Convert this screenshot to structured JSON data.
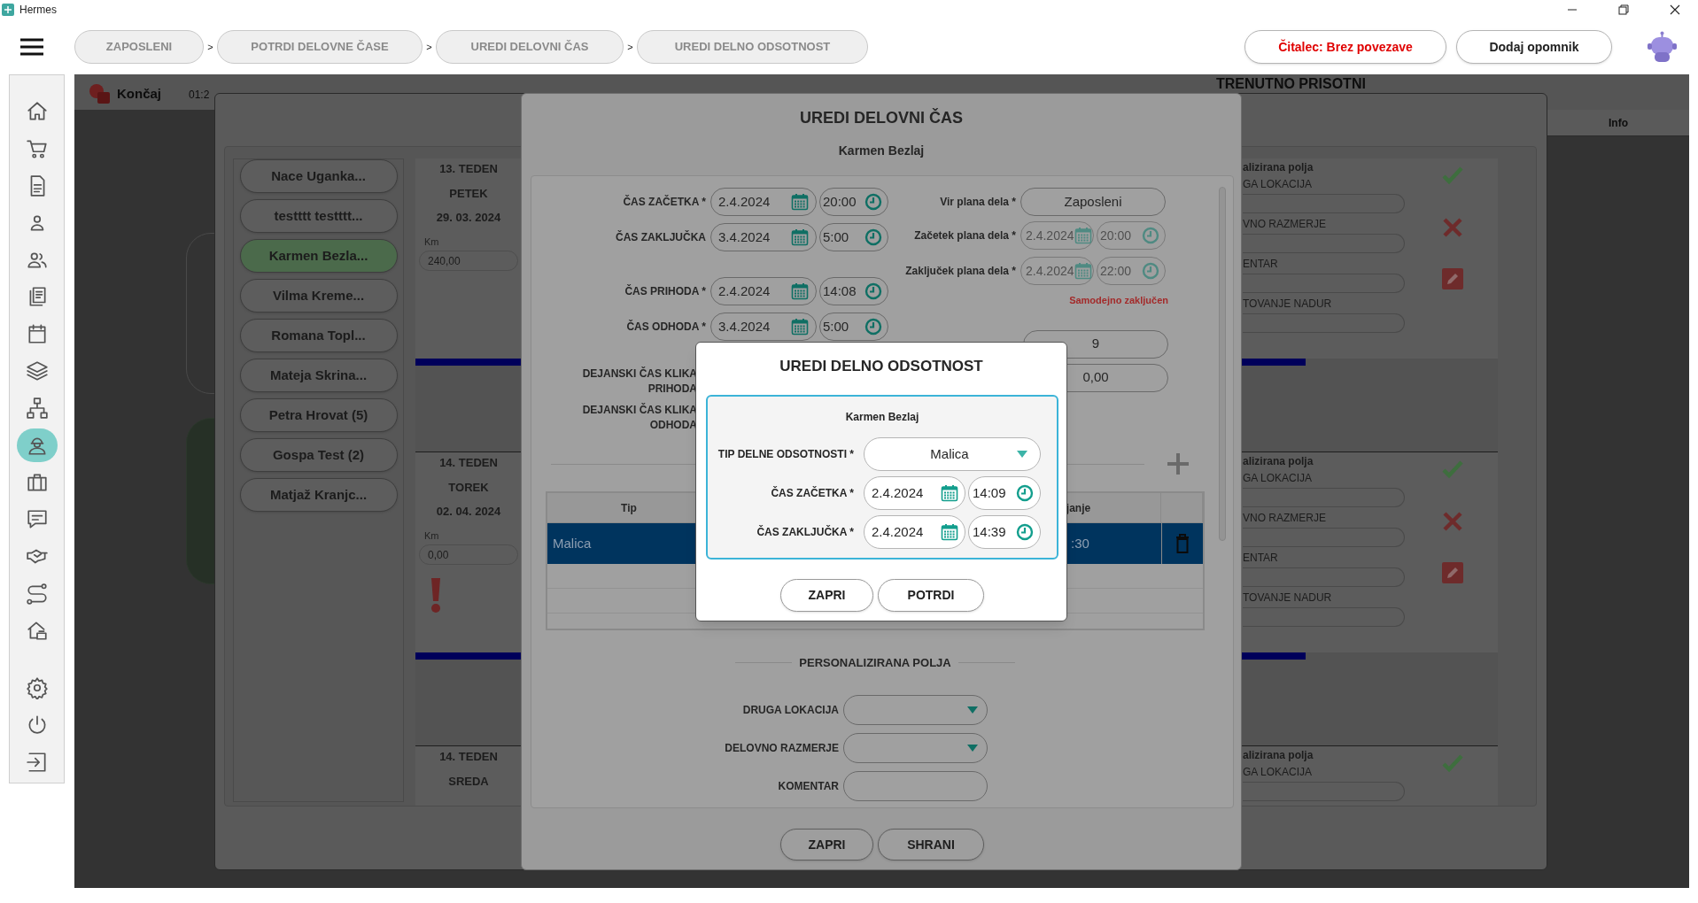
{
  "window": {
    "title": "Hermes"
  },
  "breadcrumbs": [
    {
      "label": "ZAPOSLENI"
    },
    {
      "separator": ">",
      "label": "POTRDI DELOVNE ČASE"
    },
    {
      "separator": ">",
      "label": "UREDI DELOVNI ČAS"
    },
    {
      "separator": ">",
      "label": "UREDI DELNO ODSOTNOST"
    }
  ],
  "header_buttons": [
    {
      "label": "Čitalec: Brez povezave",
      "kind": "alert"
    },
    {
      "label": "Dodaj opomnik",
      "kind": "plain"
    }
  ],
  "sidebar": {
    "items": [
      {
        "kind": "home",
        "selected": false
      },
      {
        "kind": "cart",
        "selected": false
      },
      {
        "kind": "document",
        "selected": false
      },
      {
        "kind": "person",
        "selected": false
      },
      {
        "kind": "people",
        "selected": false
      },
      {
        "kind": "documents",
        "selected": false
      },
      {
        "kind": "calendar",
        "selected": false
      },
      {
        "kind": "layers",
        "selected": false
      },
      {
        "kind": "network",
        "selected": false
      },
      {
        "kind": "worker",
        "selected": true
      },
      {
        "kind": "briefcase",
        "selected": false
      },
      {
        "kind": "chat",
        "selected": false
      },
      {
        "kind": "handshake",
        "selected": false
      },
      {
        "kind": "route",
        "selected": false
      },
      {
        "kind": "house",
        "selected": false
      },
      {
        "kind": "settings",
        "selected": false
      },
      {
        "kind": "power",
        "selected": false
      },
      {
        "kind": "exit",
        "selected": false
      }
    ]
  },
  "background": {
    "end_label": "Končaj",
    "timer": "01:2",
    "present_title": "TRENUTNO PRISOTNI",
    "present_column": "Info"
  },
  "employees": [
    {
      "label": "Nace Uganka...",
      "selected": false
    },
    {
      "label": "testttt testttt...",
      "selected": false
    },
    {
      "label": "Karmen Bezla...",
      "selected": true
    },
    {
      "label": "Vilma Kreme...",
      "selected": false
    },
    {
      "label": "Romana Topl...",
      "selected": false
    },
    {
      "label": "Mateja Skrina...",
      "selected": false
    },
    {
      "label": "Petra Hrovat (5)",
      "selected": false
    },
    {
      "label": "Gospa Test (2)",
      "selected": false
    },
    {
      "label": "Matjaž Kranjc...",
      "selected": false
    }
  ],
  "days": [
    {
      "week": "13. TEDEN",
      "day": "PETEK",
      "date": "29. 03. 2024",
      "km_label": "Km",
      "km": "240,00",
      "warning": false,
      "panel": {
        "heading": "alizirana polja",
        "fields": [
          "GA LOKACIJA",
          "VNO RAZMERJE",
          "ENTAR",
          "TOVANJE NADUR"
        ],
        "actions": [
          {
            "kind": "confirm"
          },
          {
            "kind": "reject"
          },
          {
            "kind": "edit"
          }
        ]
      }
    },
    {
      "week": "14. TEDEN",
      "day": "TOREK",
      "date": "02. 04. 2024",
      "km_label": "Km",
      "km": "0,00",
      "warning": true,
      "panel": {
        "heading": "alizirana polja",
        "fields": [
          "GA LOKACIJA",
          "VNO RAZMERJE",
          "ENTAR",
          "TOVANJE NADUR"
        ],
        "actions": [
          {
            "kind": "confirm"
          },
          {
            "kind": "reject"
          },
          {
            "kind": "edit"
          }
        ]
      }
    },
    {
      "week": "14. TEDEN",
      "day": "SREDA",
      "panel": {
        "heading": "alizirana polja",
        "fields": [
          "GA LOKACIJA"
        ],
        "actions": [
          {
            "kind": "confirm"
          }
        ]
      }
    }
  ],
  "edit_dialog": {
    "title": "UREDI DELOVNI ČAS",
    "employee": "Karmen Bezlaj",
    "times": [
      {
        "label": "ČAS ZAČETKA *",
        "date": "2.4.2024",
        "time": "20:00"
      },
      {
        "label": "ČAS ZAKLJUČKA",
        "date": "3.4.2024",
        "time": "5:00"
      },
      {
        "label": "ČAS PRIHODA *",
        "date": "2.4.2024",
        "time": "14:08"
      },
      {
        "label": "ČAS ODHODA *",
        "date": "3.4.2024",
        "time": "5:00"
      }
    ],
    "click_labels": [
      "DEJANSKI ČAS KLIKA PRIHODA",
      "DEJANSKI ČAS KLIKA ODHODA"
    ],
    "plan_source": {
      "label": "Vir plana dela *",
      "value": "Zaposleni"
    },
    "plan_times": [
      {
        "label": "Začetek plana dela *",
        "date": "2.4.2024",
        "time": "20:00",
        "disabled": true
      },
      {
        "label": "Zaključek plana dela *",
        "date": "2.4.2024",
        "time": "22:00",
        "disabled": true
      }
    ],
    "status": "Samodejno zaključen",
    "duration": "9",
    "amount": "0,00",
    "table": {
      "columns": [
        "Tip",
        "janje"
      ],
      "rows": [
        {
          "cells": [
            "Malica",
            ":30"
          ],
          "selected": true
        }
      ]
    },
    "custom_title": "PERSONALIZIRANA POLJA",
    "custom_fields": [
      {
        "label": "DRUGA LOKACIJA",
        "kind": "select"
      },
      {
        "label": "DELOVNO RAZMERJE",
        "kind": "select"
      },
      {
        "label": "KOMENTAR",
        "kind": "text"
      }
    ],
    "buttons": [
      "ZAPRI",
      "SHRANI"
    ]
  },
  "absence_dialog": {
    "title": "UREDI DELNO ODSOTNOST",
    "employee": "Karmen Bezlaj",
    "type": {
      "label": "TIP DELNE ODSOTNOSTI *",
      "value": "Malica"
    },
    "times": [
      {
        "label": "ČAS ZAČETKA *",
        "date": "2.4.2024",
        "time": "14:09"
      },
      {
        "label": "ČAS ZAKLJUČKA *",
        "date": "2.4.2024",
        "time": "14:39"
      }
    ],
    "buttons": [
      "ZAPRI",
      "POTRDI"
    ]
  }
}
